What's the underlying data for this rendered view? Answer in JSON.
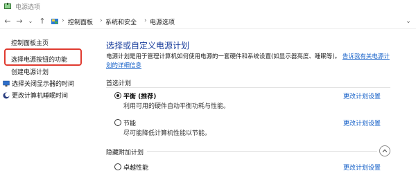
{
  "window": {
    "title": "电源选项"
  },
  "nav": {
    "breadcrumbs": [
      "控制面板",
      "系统和安全",
      "电源选项"
    ],
    "icons": {
      "back": "back-arrow",
      "forward": "forward-arrow",
      "recent": "chevron-down",
      "up": "up-arrow"
    }
  },
  "sidebar": {
    "home_link": "控制面板主页",
    "items": [
      {
        "label": "选择电源按钮的功能",
        "highlighted": true
      },
      {
        "label": "创建电源计划"
      },
      {
        "label": "选择关闭显示器的时间",
        "icon": "display-icon"
      },
      {
        "label": "更改计算机睡眠时间",
        "icon": "moon-icon"
      }
    ],
    "highlight_color": "#e03a2f"
  },
  "main": {
    "title": "选择或自定义电源计划",
    "description": "电源计划是用于管理计算机如何使用电源的一套硬件和系统设置(如显示器亮度、睡眠等)。",
    "description_link": "告诉我有关电源计划的详细信息",
    "preferred_label": "首选计划",
    "hidden_label": "隐藏附加计划",
    "plans": [
      {
        "name": "平衡 (推荐)",
        "desc": "利用可用的硬件自动平衡功耗与性能。",
        "selected": true,
        "change": "更改计划设置"
      },
      {
        "name": "节能",
        "desc": "尽可能降低计算机性能以节能。",
        "selected": false,
        "change": "更改计划设置"
      }
    ],
    "hidden_plans": [
      {
        "name": "卓越性能",
        "selected": false,
        "change": "更改计划设置"
      }
    ]
  },
  "colors": {
    "link": "#1560c8",
    "title": "#1a3e9c"
  }
}
